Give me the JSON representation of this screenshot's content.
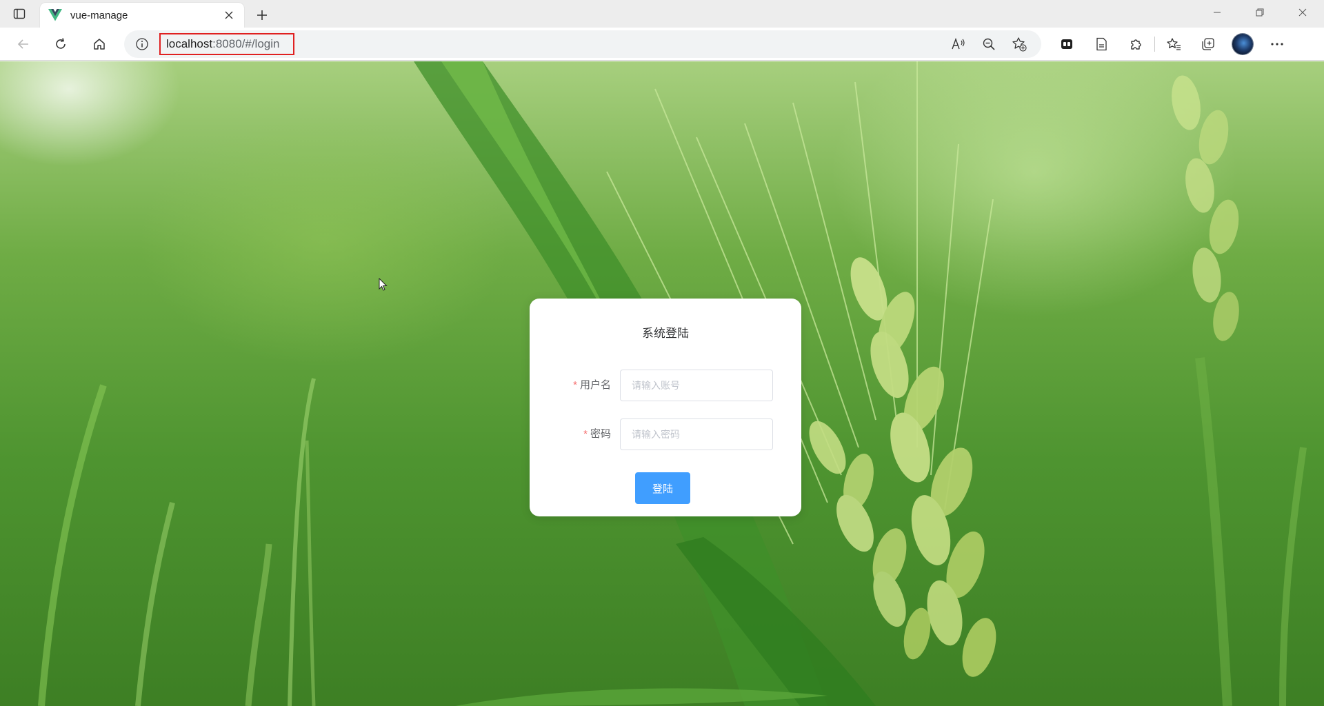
{
  "browser": {
    "tab": {
      "title": "vue-manage"
    },
    "url": {
      "host": "localhost",
      "rest": ":8080/#/login"
    },
    "icons": {
      "tab_actions": "tab-actions-icon",
      "favicon": "vue-logo-icon",
      "close": "close-icon",
      "new_tab": "plus-icon",
      "back": "back-arrow-icon",
      "refresh": "refresh-icon",
      "home": "home-icon",
      "site_info": "info-icon",
      "read_aloud": "read-aloud-icon",
      "zoom": "zoom-out-icon",
      "add_favorite": "add-favorite-icon",
      "extensions": "puzzle-icon",
      "favorites": "favorites-icon",
      "collections": "collections-icon",
      "more": "more-icon"
    }
  },
  "login": {
    "title": "系统登陆",
    "username": {
      "label": "用户名",
      "placeholder": "请输入账号"
    },
    "password": {
      "label": "密码",
      "placeholder": "请输入密码"
    },
    "submit": "登陆",
    "required_mark": "*"
  },
  "colors": {
    "primary": "#409eff",
    "required": "#f56c6c",
    "highlight_box": "#e02020"
  }
}
